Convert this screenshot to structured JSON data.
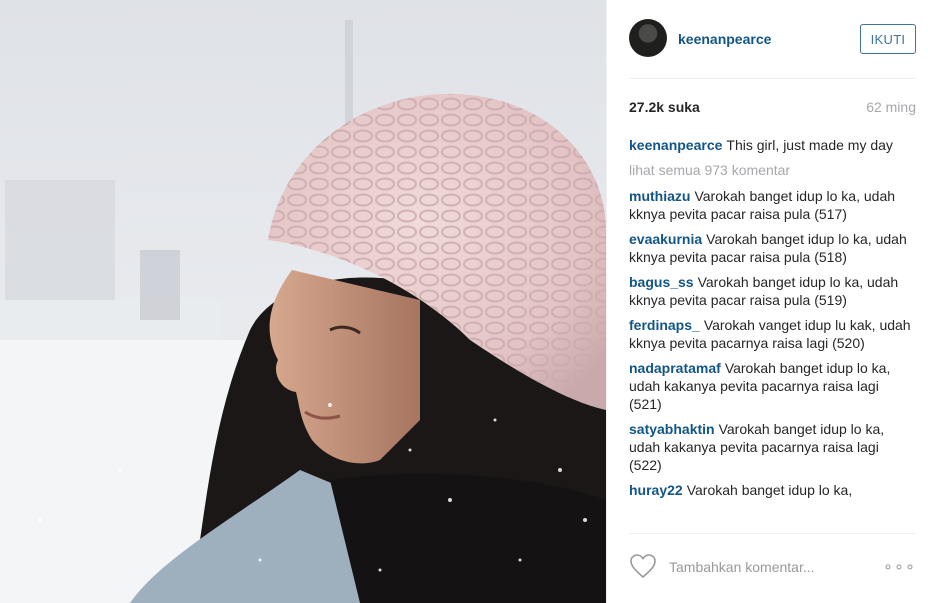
{
  "post": {
    "username": "keenanpearce",
    "follow_label": "IKUTI",
    "likes": "27.2k suka",
    "time_ago": "62 ming",
    "caption": "This girl, just made my day",
    "view_all": "lihat semua 973 komentar",
    "add_comment_placeholder": "Tambahkan komentar...",
    "more_label": "∘∘∘"
  },
  "comments": [
    {
      "user": "muthiazu",
      "text": "Varokah banget idup lo ka, udah kknya pevita pacar raisa pula (517)"
    },
    {
      "user": "evaakurnia",
      "text": "Varokah banget idup lo ka, udah kknya pevita pacar raisa pula (518)"
    },
    {
      "user": "bagus_ss",
      "text": "Varokah banget idup lo ka, udah kknya pevita pacar raisa pula (519)"
    },
    {
      "user": "ferdinaps_",
      "text": "Varokah vanget idup lu kak, udah kknya pevita pacarnya raisa lagi (520)"
    },
    {
      "user": "nadapratamaf",
      "text": "Varokah banget idup lo ka, udah kakanya pevita pacarnya raisa lagi (521)"
    },
    {
      "user": "satyabhaktin",
      "text": "Varokah banget idup lo ka, udah kakanya pevita pacarnya raisa lagi (522)"
    },
    {
      "user": "huray22",
      "text": "Varokah banget idup lo ka,"
    }
  ],
  "icons": {
    "avatar": "profile-avatar",
    "like": "heart-icon",
    "more": "more-options-icon"
  },
  "colors": {
    "link": "#125688",
    "button": "#3f729b",
    "muted": "#a5a7aa"
  }
}
